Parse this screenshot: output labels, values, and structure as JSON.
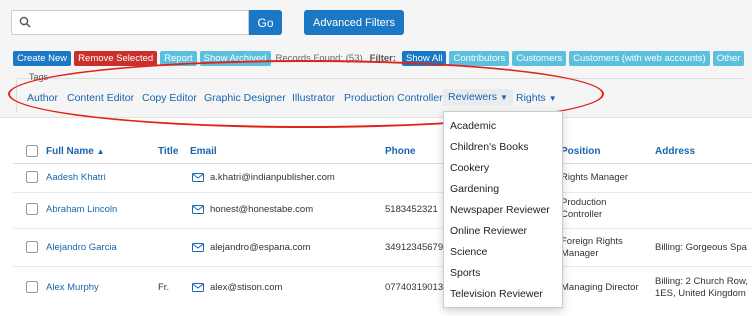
{
  "search": {
    "placeholder": "",
    "go_label": "Go",
    "advanced_label": "Advanced Filters"
  },
  "actions": {
    "create_new": "Create New",
    "remove_selected": "Remove Selected",
    "report": "Report",
    "show_archived": "Show Archived",
    "records_found": "Records Found: (53)",
    "filter_label": "Filter:",
    "filters": [
      "Show All",
      "Contributors",
      "Customers",
      "Customers (with web accounts)",
      "Other"
    ]
  },
  "tags": {
    "legend": "Tags",
    "items": [
      "Author",
      "Content Editor",
      "Copy Editor",
      "Graphic Designer",
      "Illustrator",
      "Production Controller",
      "Reviewers",
      "Rights"
    ]
  },
  "table": {
    "headers": {
      "full_name": "Full Name",
      "title": "Title",
      "email": "Email",
      "phone": "Phone",
      "position": "Position",
      "address": "Address"
    },
    "rows": [
      {
        "name": "Aadesh Khatri",
        "title": "",
        "email": "a.khatri@indianpublisher.com",
        "phone": "",
        "position": "Rights Manager",
        "address": ""
      },
      {
        "name": "Abraham Lincoln",
        "title": "",
        "email": "honest@honestabe.com",
        "phone": "5183452321",
        "position": "Production Controller",
        "address": ""
      },
      {
        "name": "Alejandro Garcia",
        "title": "",
        "email": "alejandro@espana.com",
        "phone": "34912345679",
        "position": "Foreign Rights Manager",
        "address": "Billing: Gorgeous Spa"
      },
      {
        "name": "Alex Murphy",
        "title": "Fr.",
        "email": "alex@stison.com",
        "phone": "07740319013",
        "position": "Managing Director",
        "address": "Billing: 2 Church Row, 1ES, United Kingdom"
      }
    ]
  },
  "dropdown": {
    "items": [
      "Academic",
      "Children's Books",
      "Cookery",
      "Gardening",
      "Newspaper Reviewer",
      "Online Reviewer",
      "Science",
      "Sports",
      "Television Reviewer"
    ]
  },
  "colors": {
    "primary": "#1a78c4",
    "danger": "#c9302c",
    "info": "#5bc0de",
    "annotation": "#e2231a"
  }
}
